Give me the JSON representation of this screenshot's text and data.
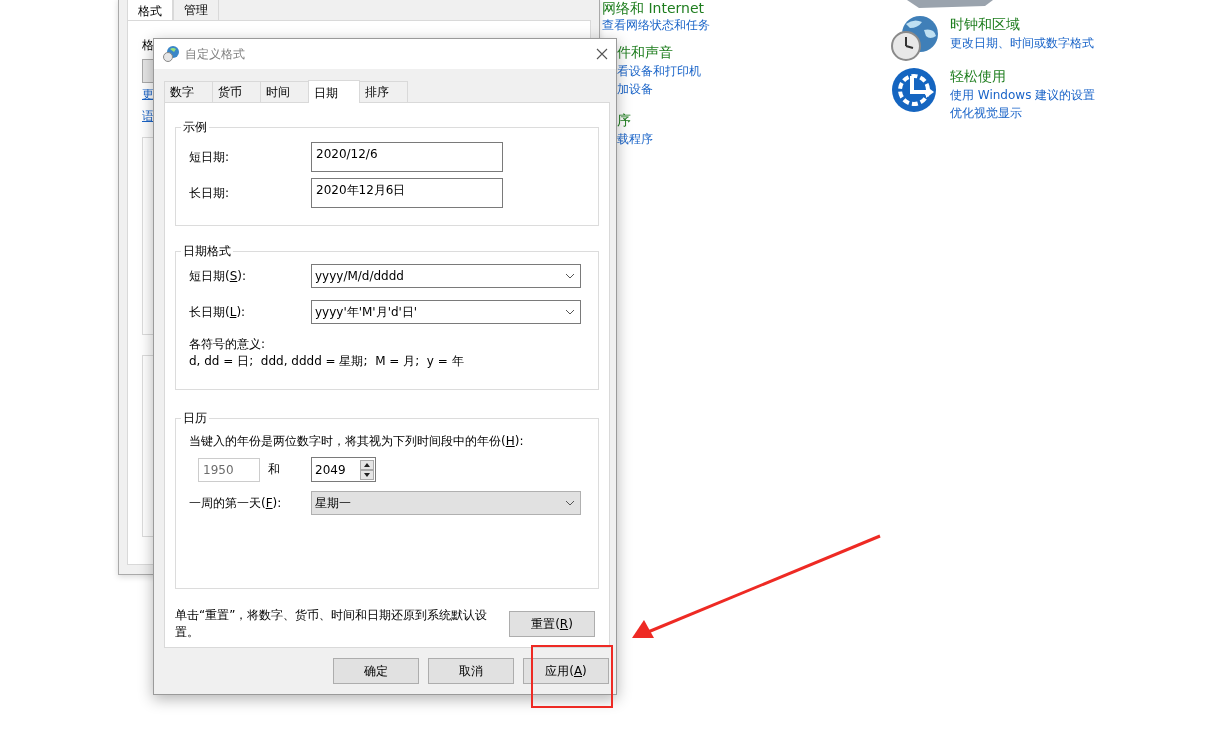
{
  "background_window": {
    "tabs": [
      {
        "label": "格式",
        "selected": true
      },
      {
        "label": "管理",
        "selected": false
      }
    ],
    "cut_label": "格",
    "cut_links": [
      "更",
      "语"
    ]
  },
  "control_panel": {
    "left_visible": [
      {
        "title": "网络和 Internet",
        "links": [
          "查看网络状态和任务"
        ]
      }
    ],
    "left_cut": [
      {
        "title": "件和声音",
        "links": [
          "看设备和打印机",
          "加设备"
        ]
      },
      {
        "title": "序",
        "links": [
          "载程序"
        ]
      }
    ],
    "right": [
      {
        "kind": "clock",
        "title": "时钟和区域",
        "links": [
          "更改日期、时间或数字格式"
        ]
      },
      {
        "kind": "access",
        "title": "轻松使用",
        "links": [
          "使用 Windows 建议的设置",
          "优化视觉显示"
        ]
      }
    ]
  },
  "dialog": {
    "title": "自定义格式",
    "tabs": [
      {
        "label": "数字",
        "selected": false
      },
      {
        "label": "货币",
        "selected": false
      },
      {
        "label": "时间",
        "selected": false
      },
      {
        "label": "日期",
        "selected": true
      },
      {
        "label": "排序",
        "selected": false
      }
    ],
    "example": {
      "legend": "示例",
      "rows": [
        {
          "label": "短日期:",
          "value": "2020/12/6"
        },
        {
          "label": "长日期:",
          "value": "2020年12月6日"
        }
      ]
    },
    "date_formats": {
      "legend": "日期格式",
      "rows": [
        {
          "label": [
            "短日期(",
            "S",
            "):"
          ],
          "value": "yyyy/M/d/dddd"
        },
        {
          "label": [
            "长日期(",
            "L",
            "):"
          ],
          "value": "yyyy'年'M'月'd'日'"
        }
      ],
      "meaning_title": "各符号的意义:",
      "meaning": "d, dd = 日;  ddd, dddd = 星期;  M = 月;  y = 年"
    },
    "calendar": {
      "legend": "日历",
      "two_digit_text": [
        "当键入的年份是两位数字时，将其视为下列时间段中的年份(",
        "H",
        "):"
      ],
      "from_year": {
        "value": "1950",
        "disabled": true
      },
      "and": "和",
      "to_year": "2049",
      "first_day": {
        "label": [
          "一周的第一天(",
          "F",
          "):"
        ],
        "value": "星期一"
      }
    },
    "reset_text": "单击“重置”，将数字、货币、时间和日期还原到系统默认设置。",
    "reset_button": {
      "label": [
        "重置(",
        "R",
        ")"
      ]
    },
    "buttons": [
      {
        "label": [
          "确定"
        ]
      },
      {
        "label": [
          "取消"
        ]
      },
      {
        "label": [
          "应用(",
          "A",
          ")"
        ]
      }
    ]
  }
}
